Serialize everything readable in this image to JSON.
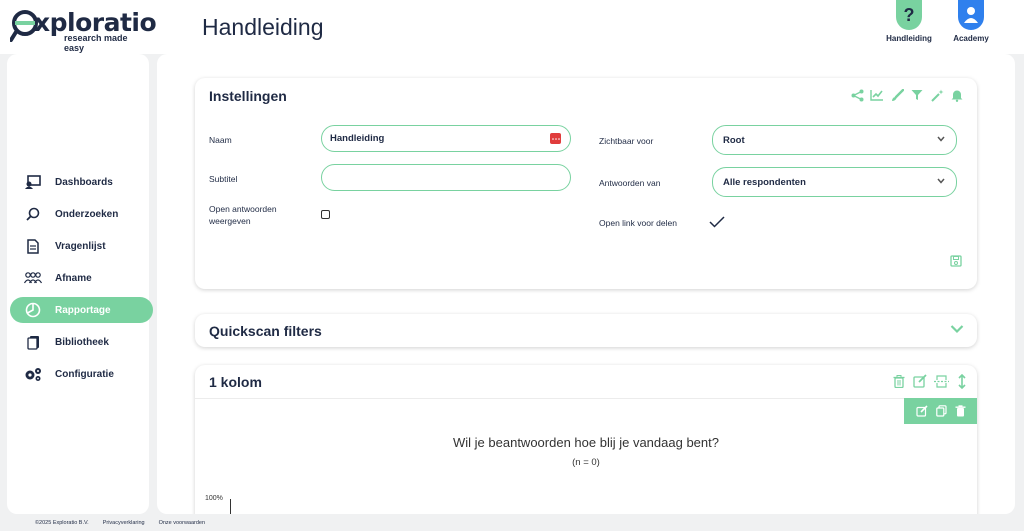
{
  "header": {
    "logo_main": "xploratio",
    "logo_sub": "research made easy",
    "page_title": "Handleiding",
    "buttons": [
      {
        "label": "Handleiding",
        "icon": "question-icon",
        "color": "#79d2a0"
      },
      {
        "label": "Academy",
        "icon": "user-icon",
        "color": "#2f80ed"
      }
    ]
  },
  "sidebar": {
    "items": [
      {
        "label": "Dashboards",
        "icon": "dashboard-icon",
        "active": false
      },
      {
        "label": "Onderzoeken",
        "icon": "search-icon",
        "active": false
      },
      {
        "label": "Vragenlijst",
        "icon": "document-icon",
        "active": false
      },
      {
        "label": "Afname",
        "icon": "users-icon",
        "active": false
      },
      {
        "label": "Rapportage",
        "icon": "pie-chart-icon",
        "active": true
      },
      {
        "label": "Bibliotheek",
        "icon": "books-icon",
        "active": false
      },
      {
        "label": "Configuratie",
        "icon": "gears-icon",
        "active": false
      }
    ]
  },
  "settings": {
    "title": "Instellingen",
    "naam_label": "Naam",
    "naam_value": "Handleiding",
    "subtitel_label": "Subtitel",
    "subtitel_value": "",
    "open_antwoorden_label": "Open antwoorden weergeven",
    "zichtbaar_label": "Zichtbaar voor",
    "zichtbaar_value": "Root",
    "antwoorden_label": "Antwoorden van",
    "antwoorden_value": "Alle respondenten",
    "open_link_label": "Open link voor delen",
    "toolbar_icons": [
      "share-icon",
      "line-chart-icon",
      "brush-icon",
      "filter-icon",
      "magic-wand-icon",
      "bell-icon"
    ]
  },
  "quickscan": {
    "title": "Quickscan filters"
  },
  "kolom": {
    "title": "1 kolom",
    "question": "Wil je beantwoorden hoe blij je vandaag bent?",
    "n_label": "(n = 0)",
    "axis_top": "100%"
  },
  "footer": {
    "copyright": "©2025 Exploratio B.V.",
    "privacy": "Privacyverklaring",
    "terms": "Onze voorwaarden"
  },
  "colors": {
    "accent": "#79d2a0",
    "navy": "#1f2a44",
    "danger": "#e03c3c",
    "blue": "#2f80ed"
  }
}
